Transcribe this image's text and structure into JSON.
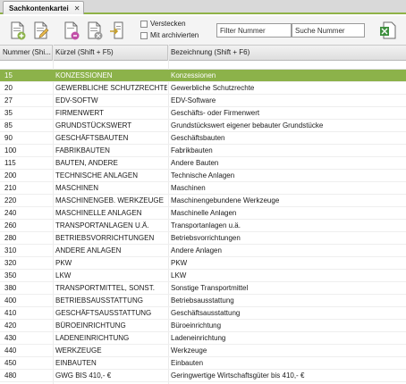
{
  "tab": {
    "title": "Sachkontenkartei",
    "close": "✕"
  },
  "options": {
    "hide_label": "Verstecken",
    "archived_label": "Mit archivierten"
  },
  "filters": {
    "number_placeholder": "Filter Nummer",
    "search_placeholder": "Suche Nummer"
  },
  "toolbar": {
    "icons": [
      "new-document-icon",
      "edit-document-icon",
      "copy-document-icon",
      "delete-document-icon",
      "export-document-icon",
      "excel-export-icon"
    ]
  },
  "columns": {
    "number": "Nummer (Shi...",
    "short": "Kürzel (Shift + F5)",
    "description": "Bezeichnung (Shift + F6)"
  },
  "colors": {
    "accent": "#8cb24a",
    "header_bg": "#e6e6e6"
  },
  "rows": [
    {
      "number": "15",
      "short": "KONZESSIONEN",
      "description": "Konzessionen",
      "selected": true
    },
    {
      "number": "20",
      "short": "GEWERBLICHE SCHUTZRECHTE",
      "description": "Gewerbliche Schutzrechte"
    },
    {
      "number": "27",
      "short": "EDV-SOFTW",
      "description": "EDV-Software"
    },
    {
      "number": "35",
      "short": "FIRMENWERT",
      "description": "Geschäfts- oder Firmenwert"
    },
    {
      "number": "85",
      "short": "GRUNDSTÜCKSWERT",
      "description": "Grundstückswert eigener bebauter Grundstücke"
    },
    {
      "number": "90",
      "short": "GESCHÄFTSBAUTEN",
      "description": "Geschäftsbauten"
    },
    {
      "number": "100",
      "short": "FABRIKBAUTEN",
      "description": "Fabrikbauten"
    },
    {
      "number": "115",
      "short": "BAUTEN, ANDERE",
      "description": "Andere Bauten"
    },
    {
      "number": "200",
      "short": "TECHNISCHE ANLAGEN",
      "description": "Technische Anlagen"
    },
    {
      "number": "210",
      "short": "MASCHINEN",
      "description": "Maschinen"
    },
    {
      "number": "220",
      "short": "MASCHINENGEB. WERKZEUGE",
      "description": "Maschinengebundene Werkzeuge"
    },
    {
      "number": "240",
      "short": "MASCHINELLE ANLAGEN",
      "description": "Maschinelle Anlagen"
    },
    {
      "number": "260",
      "short": "TRANSPORTANLAGEN U.Ä.",
      "description": "Transportanlagen u.ä."
    },
    {
      "number": "280",
      "short": "BETRIEBSVORRICHTUNGEN",
      "description": "Betriebsvorrichtungen"
    },
    {
      "number": "310",
      "short": "ANDERE ANLAGEN",
      "description": "Andere Anlagen"
    },
    {
      "number": "320",
      "short": "PKW",
      "description": "PKW"
    },
    {
      "number": "350",
      "short": "LKW",
      "description": "LKW"
    },
    {
      "number": "380",
      "short": "TRANSPORTMITTEL, SONST.",
      "description": "Sonstige Transportmittel"
    },
    {
      "number": "400",
      "short": "BETRIEBSAUSSTATTUNG",
      "description": "Betriebsausstattung"
    },
    {
      "number": "410",
      "short": "GESCHÄFTSAUSSTATTUNG",
      "description": "Geschäftsausstattung"
    },
    {
      "number": "420",
      "short": "BÜROEINRICHTUNG",
      "description": "Büroeinrichtung"
    },
    {
      "number": "430",
      "short": "LADENEINRICHTUNG",
      "description": "Ladeneinrichtung"
    },
    {
      "number": "440",
      "short": "WERKZEUGE",
      "description": "Werkzeuge"
    },
    {
      "number": "450",
      "short": "EINBAUTEN",
      "description": "Einbauten"
    },
    {
      "number": "480",
      "short": "GWG BIS 410,- €",
      "description": "Geringwertige Wirtschaftsgüter bis 410,- €"
    }
  ]
}
